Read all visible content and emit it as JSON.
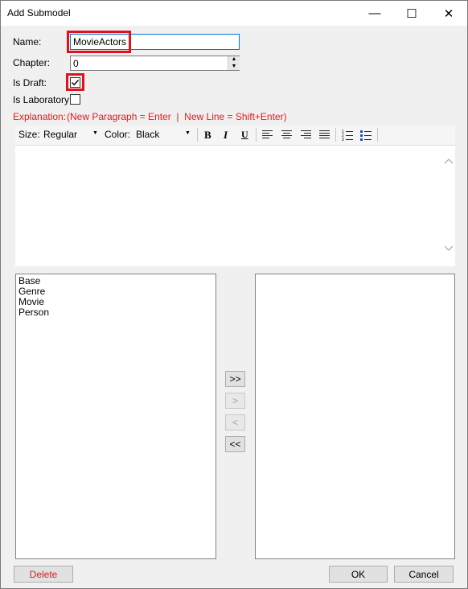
{
  "window": {
    "title": "Add Submodel",
    "minimize_glyph": "—",
    "maximize_glyph": "☐",
    "close_glyph": "✕"
  },
  "form": {
    "name_label": "Name:",
    "name_value": "MovieActors",
    "chapter_label": "Chapter:",
    "chapter_value": "0",
    "is_draft_label": "Is Draft:",
    "is_draft_checked": true,
    "is_laboratory_label": "Is Laboratory:",
    "is_laboratory_checked": false,
    "explanation_label": "Explanation:",
    "explanation_hint": "(New Paragraph = Enter  |  New Line = Shift+Enter)",
    "explanation_text": ""
  },
  "toolbar": {
    "size_label": "Size:",
    "size_value": "Regular",
    "color_label": "Color:",
    "color_value": "Black",
    "bold_glyph": "B",
    "italic_glyph": "I",
    "underline_glyph": "U"
  },
  "lists": {
    "available": [
      "Base",
      "Genre",
      "Movie",
      "Person"
    ],
    "selected": []
  },
  "transfer_buttons": {
    "add_all": ">>",
    "add_one": ">",
    "remove_one": "<",
    "remove_all": "<<"
  },
  "footer": {
    "delete_label": "Delete",
    "ok_label": "OK",
    "cancel_label": "Cancel"
  },
  "colors": {
    "highlight_red": "#e0121c",
    "hint_red": "#e8191c",
    "delete_red": "#d62020"
  }
}
